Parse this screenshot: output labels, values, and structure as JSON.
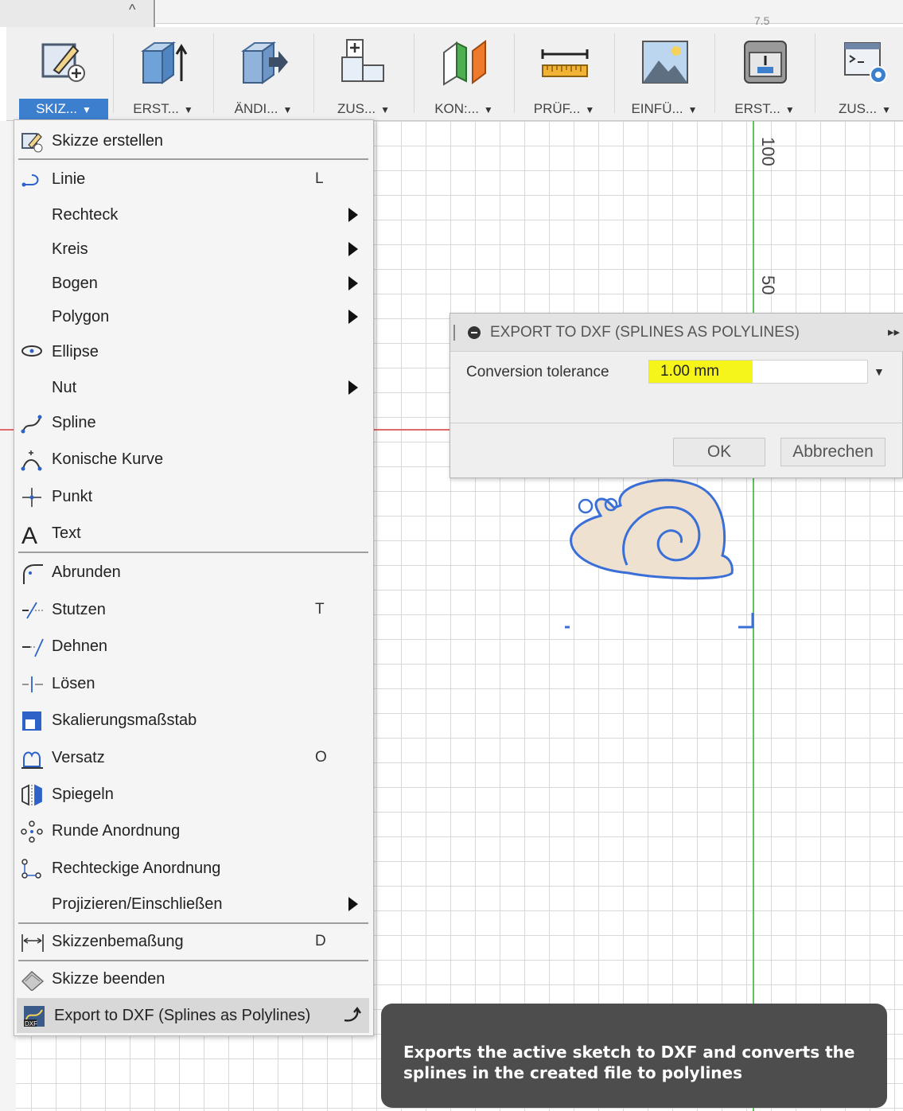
{
  "top_strip": {
    "tab_caret": "^",
    "fragment": "7.5"
  },
  "toolbar": {
    "groups": [
      {
        "label": "SKIZ...",
        "icon": "sketch-create-icon"
      },
      {
        "label": "ERST...",
        "icon": "extrude-box-icon"
      },
      {
        "label": "ÄNDI...",
        "icon": "modify-box-icon"
      },
      {
        "label": "ZUS...",
        "icon": "assemble-blocks-icon"
      },
      {
        "label": "KON:...",
        "icon": "construct-planes-icon"
      },
      {
        "label": "PRÜF...",
        "icon": "inspect-ruler-icon"
      },
      {
        "label": "EINFÜ...",
        "icon": "insert-image-icon"
      },
      {
        "label": "ERST...",
        "icon": "make-printer-icon"
      },
      {
        "label": "ZUS...",
        "icon": "addins-script-icon"
      }
    ],
    "arrow": "▼"
  },
  "canvas": {
    "axis_tick_100": "100",
    "axis_tick_50": "50"
  },
  "menu": {
    "items": [
      {
        "label": "Skizze erstellen",
        "key": "",
        "icon": "sketch-create-icon"
      },
      {
        "label": "Linie",
        "key": "L",
        "icon": "line-icon"
      },
      {
        "label": "Rechteck",
        "key": "",
        "icon": ""
      },
      {
        "label": "Kreis",
        "key": "",
        "icon": ""
      },
      {
        "label": "Bogen",
        "key": "",
        "icon": ""
      },
      {
        "label": "Polygon",
        "key": "",
        "icon": ""
      },
      {
        "label": "Ellipse",
        "key": "",
        "icon": "ellipse-icon"
      },
      {
        "label": "Nut",
        "key": "",
        "icon": ""
      },
      {
        "label": "Spline",
        "key": "",
        "icon": "spline-icon"
      },
      {
        "label": "Konische Kurve",
        "key": "",
        "icon": "conic-curve-icon"
      },
      {
        "label": "Punkt",
        "key": "",
        "icon": "point-icon"
      },
      {
        "label": "Text",
        "key": "",
        "icon": "text-icon"
      },
      {
        "label": "Abrunden",
        "key": "",
        "icon": "fillet-icon"
      },
      {
        "label": "Stutzen",
        "key": "T",
        "icon": "trim-icon"
      },
      {
        "label": "Dehnen",
        "key": "",
        "icon": "extend-icon"
      },
      {
        "label": "Lösen",
        "key": "",
        "icon": "break-icon"
      },
      {
        "label": "Skalierungsmaßstab",
        "key": "",
        "icon": "scale-icon"
      },
      {
        "label": "Versatz",
        "key": "O",
        "icon": "offset-icon"
      },
      {
        "label": "Spiegeln",
        "key": "",
        "icon": "mirror-icon"
      },
      {
        "label": "Runde Anordnung",
        "key": "",
        "icon": "circular-pattern-icon"
      },
      {
        "label": "Rechteckige Anordnung",
        "key": "",
        "icon": "rectangular-pattern-icon"
      },
      {
        "label": "Projizieren/Einschließen",
        "key": "",
        "icon": ""
      },
      {
        "label": "Skizzenbemaßung",
        "key": "D",
        "icon": "dimension-icon"
      },
      {
        "label": "Skizze beenden",
        "key": "",
        "icon": "stop-sketch-icon"
      },
      {
        "label": "Export to DXF (Splines as Polylines)",
        "key": "",
        "icon": "dxf-export-icon"
      }
    ]
  },
  "dialog": {
    "title": "EXPORT TO DXF (SPLINES AS POLYLINES)",
    "expand": "▸▸",
    "field_label": "Conversion tolerance",
    "field_value": "1.00 mm",
    "dropdown_arrow": "▼",
    "ok_label": "OK",
    "cancel_label": "Abbrechen"
  },
  "tooltip": {
    "text": "Exports the active sketch to DXF and converts the splines in the created file to polylines"
  },
  "colors": {
    "accent": "#3c7fcf",
    "highlight": "#f5f51c",
    "axis_green": "#5fc25f",
    "axis_red": "#e06a6a",
    "sketch_blue": "#3a6fd8",
    "tooltip_bg": "#4d4d4d"
  }
}
